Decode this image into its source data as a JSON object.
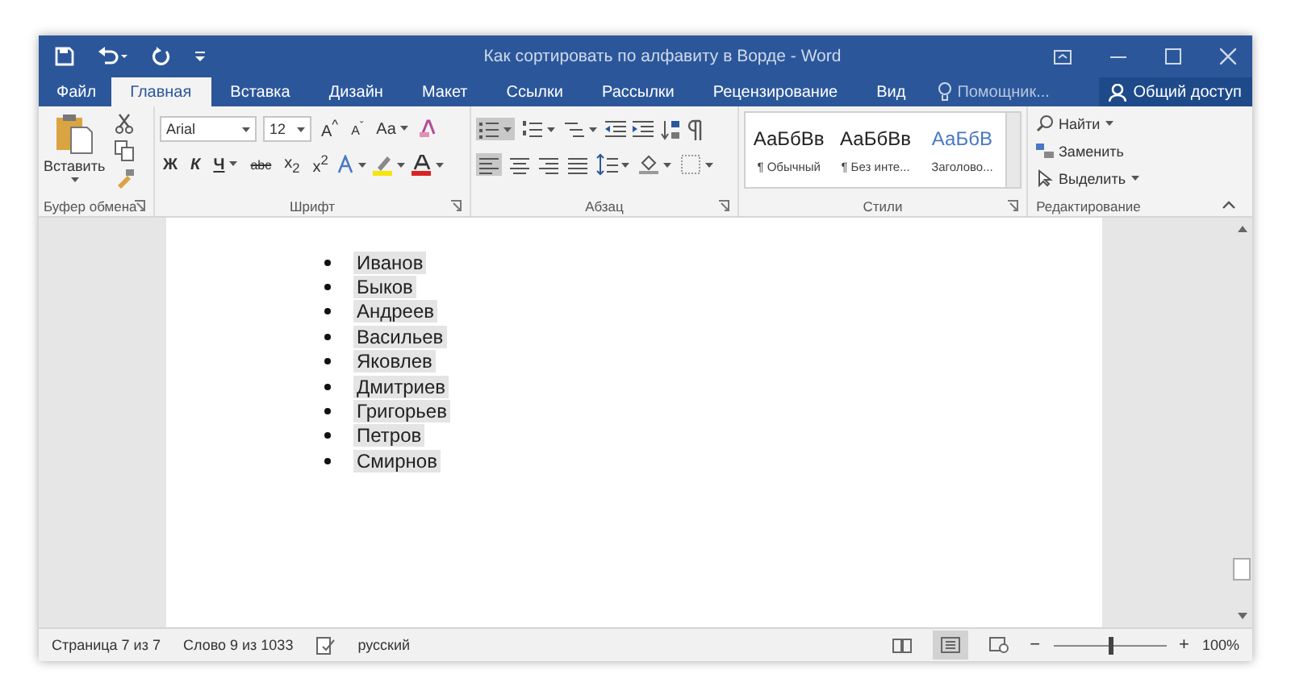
{
  "window": {
    "title": "Как сортировать по алфавиту в Ворде - Word"
  },
  "tabs": [
    {
      "label": "Файл",
      "selected": false
    },
    {
      "label": "Главная",
      "selected": true
    },
    {
      "label": "Вставка",
      "selected": false
    },
    {
      "label": "Дизайн",
      "selected": false
    },
    {
      "label": "Макет",
      "selected": false
    },
    {
      "label": "Ссылки",
      "selected": false
    },
    {
      "label": "Рассылки",
      "selected": false
    },
    {
      "label": "Рецензирование",
      "selected": false
    },
    {
      "label": "Вид",
      "selected": false
    }
  ],
  "tell_me": {
    "placeholder": "Помощник..."
  },
  "share_button": "Общий доступ",
  "clipboard": {
    "paste": "Вставить",
    "group_label": "Буфер обмена"
  },
  "font": {
    "name": "Arial",
    "size": "12",
    "case": "Aa",
    "bold": "Ж",
    "italic": "К",
    "underline": "Ч",
    "strike": "abc",
    "subscript": "x$_{2}$",
    "superscript": "x$^{2}$",
    "grow": "A$^{^}$",
    "shrink": "A$^{ˇ}$",
    "group_label": "Шрифт"
  },
  "paragraph": {
    "group_label": "Абзац"
  },
  "styles": {
    "items": [
      {
        "preview": "АаБбВв",
        "name": "¶ Обычный",
        "kind": "normal"
      },
      {
        "preview": "АаБбВв",
        "name": "¶ Без инте...",
        "kind": "normal"
      },
      {
        "preview": "АаБбВ",
        "name": "Заголово...",
        "kind": "heading"
      }
    ],
    "group_label": "Стили"
  },
  "editing": {
    "find": "Найти",
    "replace": "Заменить",
    "select": "Выделить",
    "group_label": "Редактирование"
  },
  "document": {
    "selected": true,
    "items": [
      "Иванов",
      "Быков",
      "Андреев",
      "Васильев",
      "Яковлев",
      "Дмитриев",
      "Григорьев",
      "Петров",
      "Смирнов"
    ]
  },
  "status_bar": {
    "page": "Страница 7 из 7",
    "words": "Слово 9 из 1033",
    "language": "русский",
    "zoom": "100%",
    "zoom_out": "−",
    "zoom_in": "+",
    "level": 0.5,
    "views": [
      {
        "kind": "read",
        "selected": false
      },
      {
        "kind": "print",
        "selected": true
      },
      {
        "kind": "web",
        "selected": false
      }
    ]
  }
}
